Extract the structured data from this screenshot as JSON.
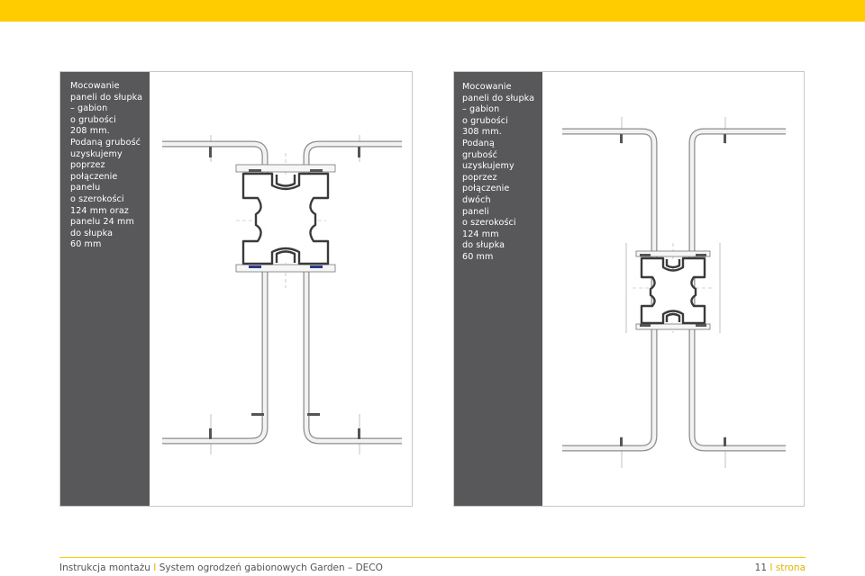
{
  "header": {
    "bar_color": "#ffcc00"
  },
  "left_panel": {
    "text": "Mocowanie\npaneli do słupka\n– gabion\no grubości\n208 mm.\nPodaną grubość\nuzyskujemy\npoprzez\npołączenie\npanelu\no szerokości\n124 mm oraz\npanelu 24 mm\ndo słupka\n60 mm"
  },
  "right_panel": {
    "text": "Mocowanie\npaneli  do słupka\n– gabion\no grubości\n308 mm.\nPodaną\ngrubość\nuzyskujemy\npoprzez\npołączenie\ndwóch\npaneli\no szerokości\n124 mm\ndo słupka\n60 mm"
  },
  "footer": {
    "title_part1": "Instrukcja montażu",
    "separator": "I",
    "title_part2": "System ogrodzeń gabionowych Garden – DECO",
    "page_number": "11",
    "page_label": "strona"
  },
  "colors": {
    "accent": "#ffcc00",
    "sidebar": "#58585a"
  }
}
